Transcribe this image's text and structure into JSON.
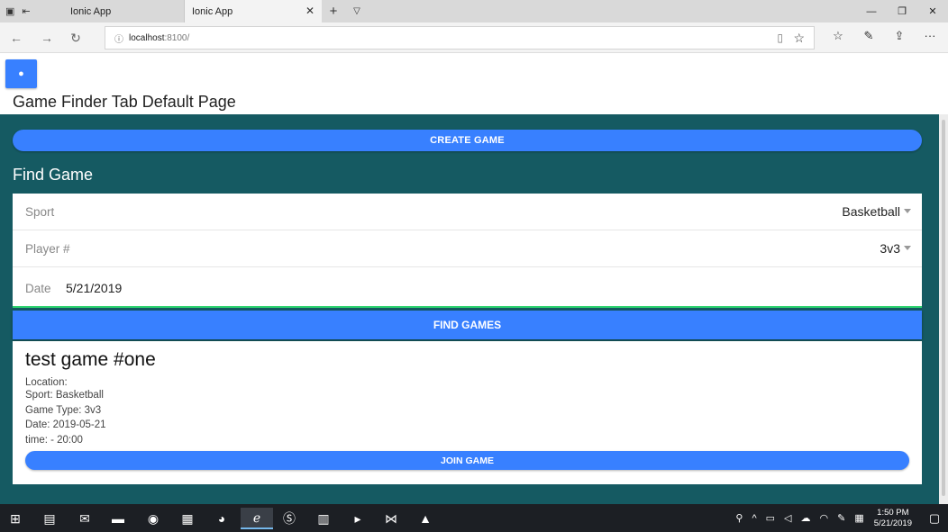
{
  "browser": {
    "tabs": [
      {
        "title": "Ionic App",
        "active": false
      },
      {
        "title": "Ionic App",
        "active": true
      }
    ],
    "url_host": "localhost",
    "url_rest": ":8100/"
  },
  "header": {
    "title": "Game Finder Tab Default Page",
    "user_icon": "person-icon"
  },
  "main": {
    "create_button": "CREATE GAME",
    "section_title": "Find Game",
    "form": {
      "sport_label": "Sport",
      "sport_value": "Basketball",
      "players_label": "Player #",
      "players_value": "3v3",
      "date_label": "Date",
      "date_value": "5/21/2019"
    },
    "find_button": "FIND GAMES",
    "game_card": {
      "title": "test game #one",
      "location": "Location:",
      "sport": "Sport: Basketball",
      "game_type": "Game Type: 3v3",
      "date": "Date: 2019-05-21",
      "time": "time: - 20:00",
      "join_button": "JOIN GAME"
    }
  },
  "taskbar": {
    "time": "1:50 PM",
    "date": "5/21/2019"
  },
  "colors": {
    "primary": "#3880ff",
    "content_bg": "#155a62",
    "success": "#2dd36f",
    "taskbar": "#1c1f24"
  }
}
